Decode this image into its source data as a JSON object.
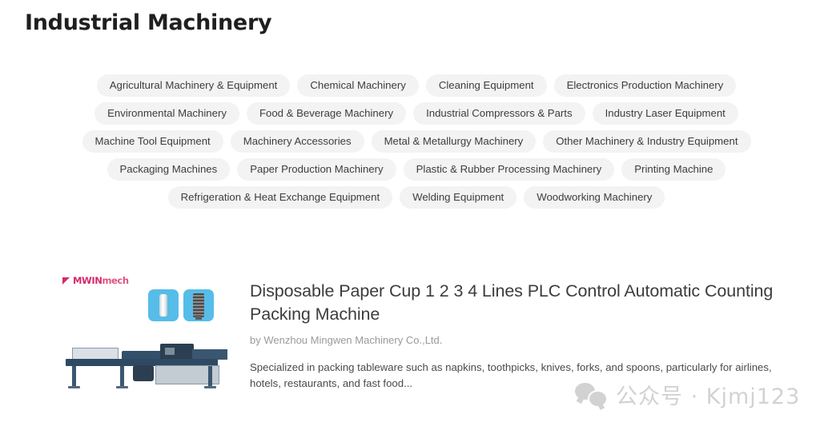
{
  "page": {
    "title": "Industrial Machinery"
  },
  "tag_cloud": {
    "rows": [
      [
        {
          "label": "Agricultural Machinery & Equipment"
        },
        {
          "label": "Chemical Machinery"
        },
        {
          "label": "Cleaning Equipment"
        },
        {
          "label": "Electronics Production Machinery"
        }
      ],
      [
        {
          "label": "Environmental Machinery"
        },
        {
          "label": "Food & Beverage Machinery"
        },
        {
          "label": "Industrial Compressors & Parts"
        },
        {
          "label": "Industry Laser Equipment"
        }
      ],
      [
        {
          "label": "Machine Tool Equipment"
        },
        {
          "label": "Machinery Accessories"
        },
        {
          "label": "Metal & Metallurgy Machinery"
        },
        {
          "label": "Other Machinery & Industry Equipment"
        }
      ],
      [
        {
          "label": "Packaging Machines"
        },
        {
          "label": "Paper Production Machinery"
        },
        {
          "label": "Plastic & Rubber Processing Machinery"
        },
        {
          "label": "Printing Machine"
        }
      ],
      [
        {
          "label": "Refrigeration & Heat Exchange Equipment"
        },
        {
          "label": "Welding Equipment"
        },
        {
          "label": "Woodworking Machinery"
        }
      ]
    ]
  },
  "product": {
    "brand_logo_text_primary": "MWIN",
    "brand_logo_text_secondary": "mech",
    "logo_icon": "flag-mark-icon",
    "thumbnails": [
      {
        "name": "paper-cup-thumbnail"
      },
      {
        "name": "stacked-cups-thumbnail"
      }
    ],
    "main_photo_name": "packing-machine-photo",
    "title": "Disposable Paper Cup 1 2 3 4 Lines PLC Control Automatic Counting Packing Machine",
    "vendor": "by Wenzhou Mingwen Machinery Co.,Ltd.",
    "description": "Specialized in packing tableware such as napkins, toothpicks, knives, forks, and spoons, particularly for airlines, hotels, restaurants, and fast food..."
  },
  "watermark": {
    "icon": "wechat-icon",
    "text": "公众号 · Kjmj123"
  },
  "colors": {
    "title": "#1f1f1f",
    "tag_background": "#f3f3f3",
    "tag_text": "#3d3d3d",
    "brand_accent": "#d6296a",
    "thumbnail_background": "#56bde8",
    "machine_body": "#2e4a63",
    "watermark": "#d2d2d2"
  }
}
